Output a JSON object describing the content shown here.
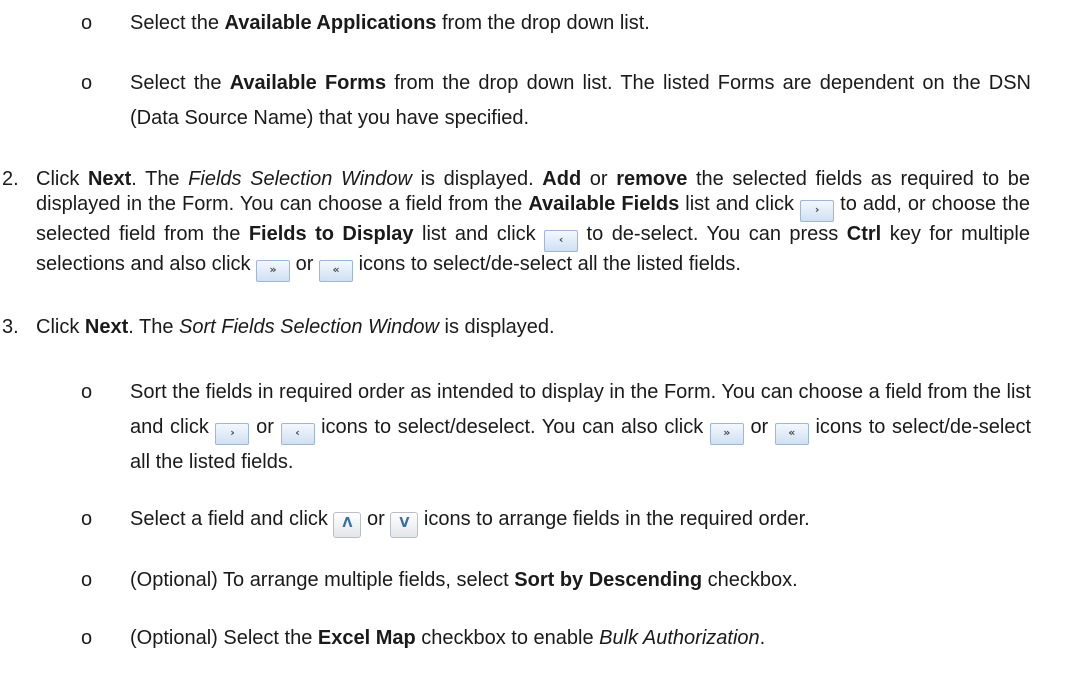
{
  "sub1": {
    "bullet": "o",
    "before": "Select the ",
    "bold": "Available Applications",
    "after": " from the drop down list."
  },
  "sub2": {
    "bullet": "o",
    "before": "Select the ",
    "bold": "Available Forms",
    "after": " from the drop down list. The listed Forms are dependent on the DSN (Data Source Name) that you have specified."
  },
  "step2": {
    "number": "2.",
    "t1": "Click ",
    "next": "Next",
    "t2": ". The ",
    "window": "Fields Selection Window",
    "t3": " is displayed. ",
    "add": "Add",
    "t4": " or ",
    "remove": "remove",
    "t5": " the selected fields as required to be displayed in the Form. You can choose a field from the ",
    "available_fields": "Available Fields",
    "t6": " list and click ",
    "t7": " to add, or choose the selected field from the ",
    "fields_to_display": "Fields to Display",
    "t8": " list and click ",
    "t9": " to de-select. You can press ",
    "ctrl": "Ctrl",
    "t10": " key for multiple selections and also click ",
    "t11": " or ",
    "t12": " icons to select/de-select all the listed fields."
  },
  "step3": {
    "number": "3.",
    "t1": "Click ",
    "next": "Next",
    "t2": ". The ",
    "window": "Sort Fields Selection Window",
    "t3": " is displayed."
  },
  "sub3": {
    "bullet": "o",
    "t1": "Sort the fields in required order as intended to display in the Form. You can choose a field from the list and click ",
    "t2": " or ",
    "t3": " icons to select/deselect. You can also click ",
    "t4": " or ",
    "t5": " icons to select/de-select all the listed fields."
  },
  "sub4": {
    "bullet": "o",
    "t1": "Select a field and click ",
    "t2": " or ",
    "t3": " icons to arrange fields in the required order."
  },
  "sub5": {
    "bullet": "o",
    "t1": "(Optional) To arrange multiple fields, select ",
    "bold": "Sort by Descending",
    "t2": " checkbox."
  },
  "sub6": {
    "bullet": "o",
    "t1": "(Optional) Select the ",
    "bold": "Excel Map",
    "t2": " checkbox to enable ",
    "italic": "Bulk Authorization",
    "t3": "."
  },
  "icons": {
    "right": "›",
    "left": "‹",
    "all_right": "»",
    "all_left": "«",
    "up": "Λ",
    "down": "V"
  }
}
